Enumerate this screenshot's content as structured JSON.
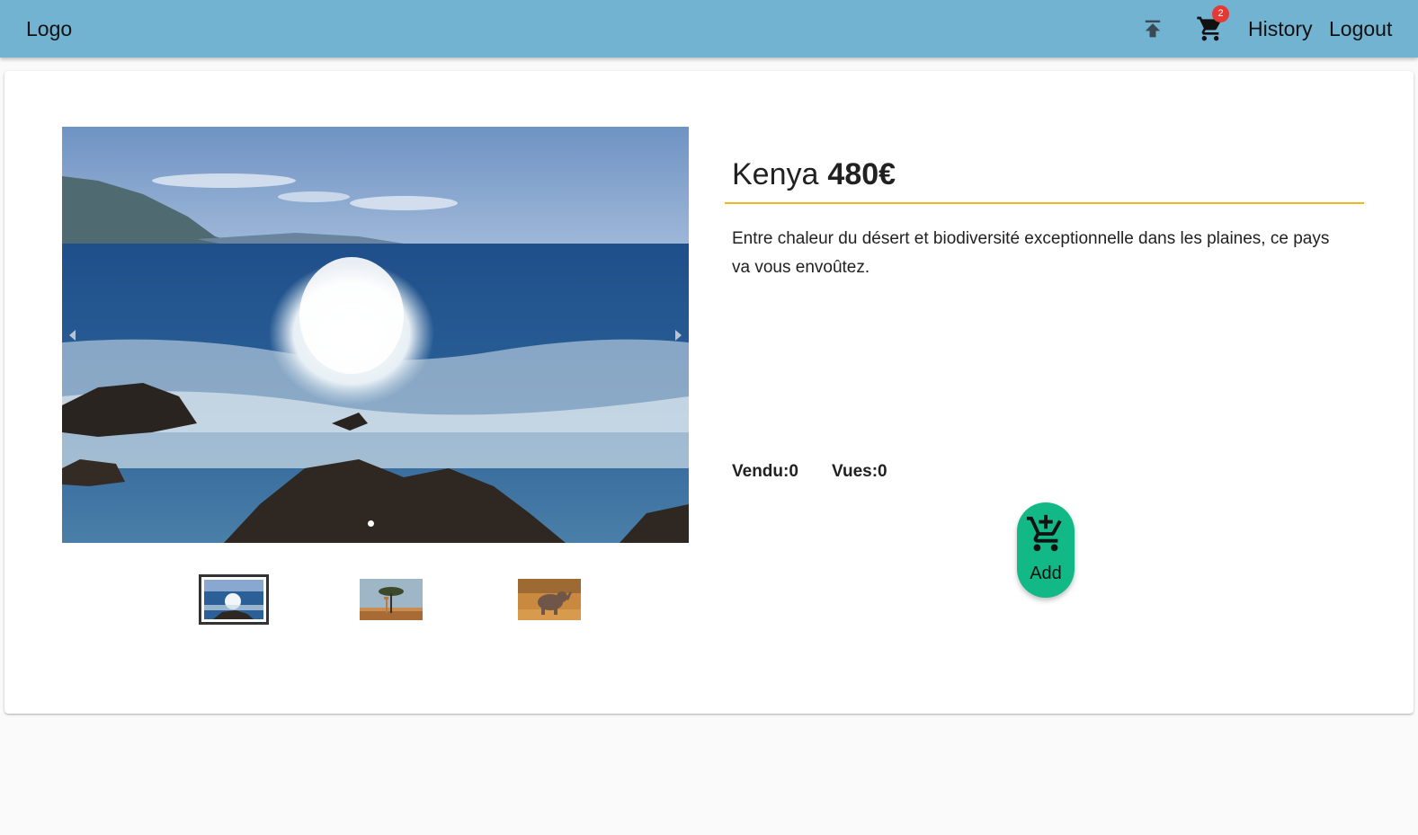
{
  "header": {
    "logo": "Logo",
    "cart_count": "2",
    "history_label": "History",
    "logout_label": "Logout",
    "icons": [
      "upload-icon",
      "cart-icon"
    ]
  },
  "product": {
    "name": "Kenya",
    "price": "480€",
    "description": "Entre chaleur du désert et biodiversité exceptionnelle dans les plaines, ce pays va vous envoûtez.",
    "sold": "Vendu:0",
    "views": "Vues:0",
    "add_label": "Add"
  },
  "gallery": {
    "images": [
      "ocean-wave-coast",
      "giraffe-acacia-savanna",
      "elephant-savanna"
    ],
    "active_index": 0
  },
  "colors": {
    "appbar": "#72b3d1",
    "accent_rule": "#f3b422",
    "add_button": "#12b886",
    "badge": "#e53935"
  }
}
